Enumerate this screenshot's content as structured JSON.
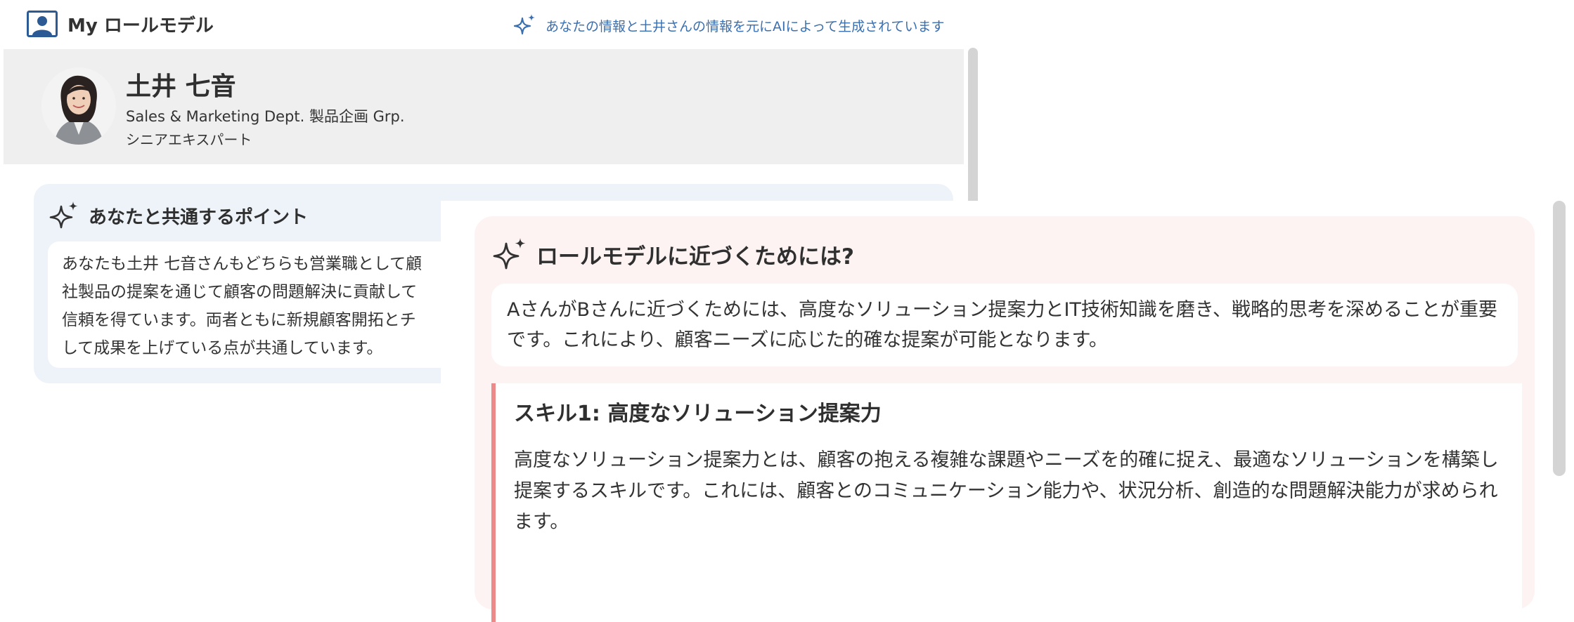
{
  "header": {
    "app_title": "My ロールモデル",
    "ai_notice": "あなたの情報と土井さんの情報を元にAIによって生成されています"
  },
  "profile": {
    "name": "土井 七音",
    "department": "Sales & Marketing Dept.  製品企画 Grp.",
    "title": "シニアエキスパート"
  },
  "common_points": {
    "title": "あなたと共通するポイント",
    "text": "あなたも土井 七音さんもどちらも営業職として顧\n社製品の提案を通じて顧客の問題解決に貢献して\n信頼を得ています。両者ともに新規顧客開拓とチ\nして成果を上げている点が共通しています。"
  },
  "role_model": {
    "title": "ロールモデルに近づくためには?",
    "summary": "AさんがBさんに近づくためには、高度なソリューション提案力とIT技術知識を磨き、戦略的思考を深めることが重要です。これにより、顧客ニーズに応じた的確な提案が可能となります。",
    "skill1_title": "スキル1: 高度なソリューション提案力",
    "skill1_desc": "高度なソリューション提案力とは、顧客の抱える複雑な課題やニーズを的確に捉え、最適なソリューションを構築し提案するスキルです。これには、顧客とのコミュニケーション能力や、状況分析、創造的な問題解決能力が求められます。"
  },
  "icons": {
    "app": "user-card-icon",
    "ai": "sparkle-icon",
    "avatar": "avatar-photo"
  },
  "colors": {
    "accent_blue": "#3a6fb0",
    "skill_border": "#ec8a8a"
  }
}
